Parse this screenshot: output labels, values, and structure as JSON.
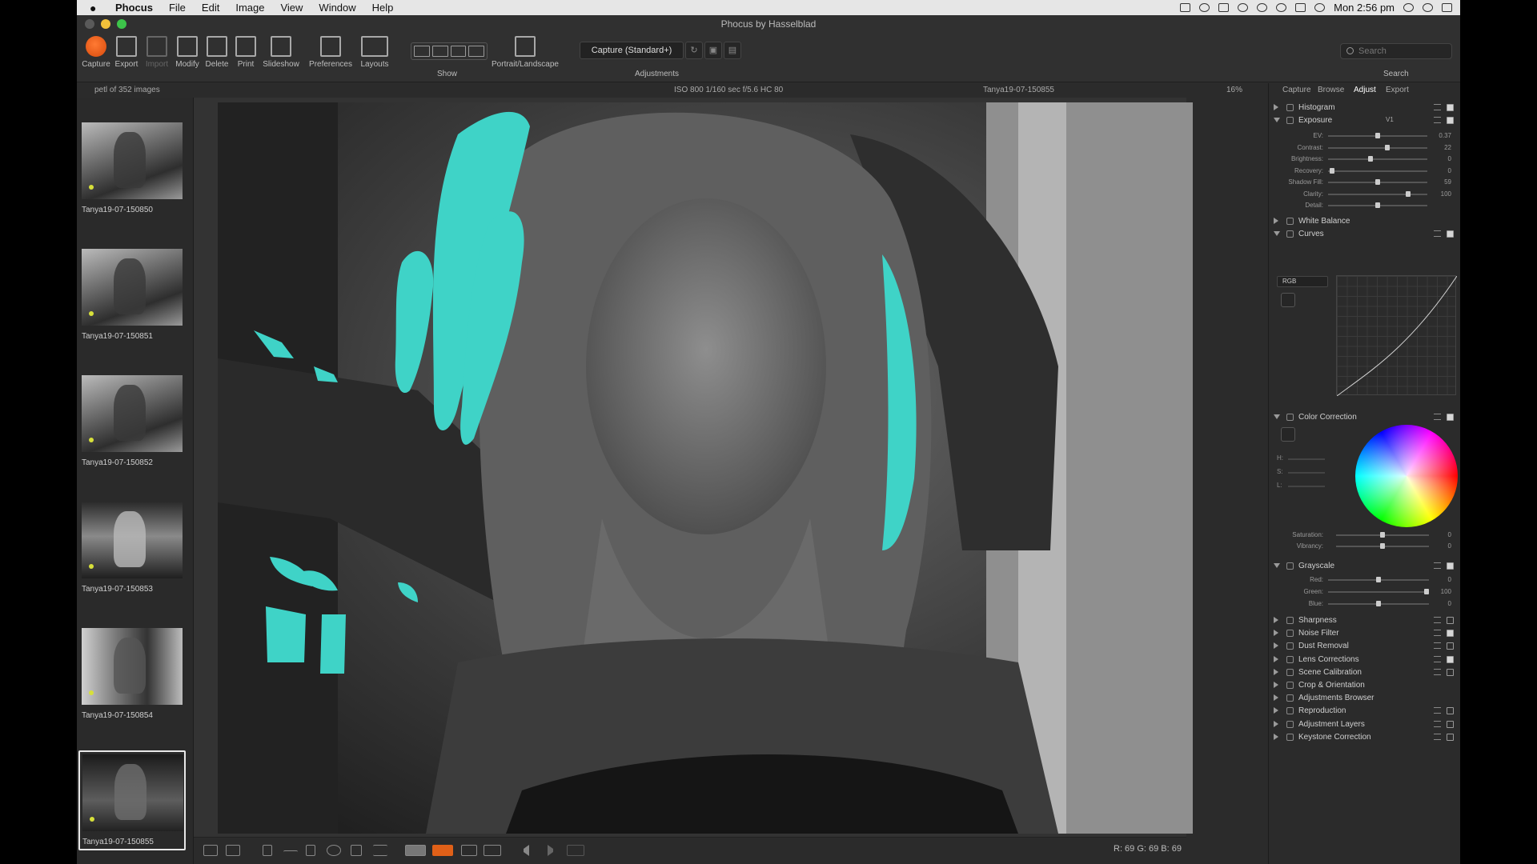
{
  "menubar": {
    "apple": "",
    "app": "Phocus",
    "items": [
      "File",
      "Edit",
      "Image",
      "View",
      "Window",
      "Help"
    ],
    "clock": "Mon 2:56 pm"
  },
  "window": {
    "title": "Phocus by Hasselblad"
  },
  "toolbar": {
    "capture": "Capture",
    "export": "Export",
    "import": "Import",
    "modify": "Modify",
    "delete": "Delete",
    "print": "Print",
    "slideshow": "Slideshow",
    "preferences": "Preferences",
    "layouts": "Layouts",
    "show": "Show",
    "portrait_landscape": "Portrait/Landscape",
    "adjustments_label": "Adjustments",
    "adjustments_value": "Capture (Standard+)",
    "search_label": "Search",
    "search_placeholder": "Search"
  },
  "infostrip": {
    "collection": "petl of 352 images",
    "exif": "ISO 800  1/160 sec  f/5.6  HC 80",
    "filename": "Tanya19-07-150855",
    "zoom": "16%"
  },
  "thumbnails": [
    {
      "name": "Tanya19-07-150850"
    },
    {
      "name": "Tanya19-07-150851"
    },
    {
      "name": "Tanya19-07-150852"
    },
    {
      "name": "Tanya19-07-150853"
    },
    {
      "name": "Tanya19-07-150854"
    },
    {
      "name": "Tanya19-07-150855"
    }
  ],
  "panel": {
    "tabs": [
      "Capture",
      "Browse",
      "Adjust",
      "Export"
    ],
    "active_tab": "Adjust",
    "histogram": "Histogram",
    "exposure": {
      "title": "Exposure",
      "version": "V1",
      "sliders": [
        {
          "label": "EV:",
          "value": "0.37",
          "level": 0.5
        },
        {
          "label": "Contrast:",
          "value": "22",
          "level": 0.6
        },
        {
          "label": "Brightness:",
          "value": "0",
          "level": 0.42
        },
        {
          "label": "Recovery:",
          "value": "0",
          "level": 0.02
        },
        {
          "label": "Shadow Fill:",
          "value": "59",
          "level": 0.5
        },
        {
          "label": "Clarity:",
          "value": "100",
          "level": 0.82
        },
        {
          "label": "Detail:",
          "value": "",
          "level": 0.5
        }
      ]
    },
    "white_balance": "White Balance",
    "curves": {
      "title": "Curves",
      "channel": "RGB"
    },
    "color_correction": {
      "title": "Color Correction",
      "h": "H:",
      "s": "S:",
      "l": "L:",
      "sliders": [
        {
          "label": "Saturation:",
          "value": "0",
          "level": 0.5
        },
        {
          "label": "Vibrancy:",
          "value": "0",
          "level": 0.5
        }
      ]
    },
    "grayscale": {
      "title": "Grayscale",
      "sliders": [
        {
          "label": "Red:",
          "value": "0",
          "level": 0.5
        },
        {
          "label": "Green:",
          "value": "100",
          "level": 1.0
        },
        {
          "label": "Blue:",
          "value": "0",
          "level": 0.5
        }
      ]
    },
    "sections": [
      {
        "name": "Sharpness",
        "checked": false
      },
      {
        "name": "Noise Filter",
        "checked": true
      },
      {
        "name": "Dust Removal",
        "checked": false
      },
      {
        "name": "Lens Corrections",
        "checked": true
      },
      {
        "name": "Scene Calibration",
        "checked": false
      },
      {
        "name": "Crop & Orientation",
        "checked": null
      },
      {
        "name": "Adjustments Browser",
        "checked": null
      },
      {
        "name": "Reproduction",
        "checked": false
      },
      {
        "name": "Adjustment Layers",
        "checked": false
      },
      {
        "name": "Keystone Correction",
        "checked": false
      }
    ]
  },
  "readout": {
    "rgb": "R:  69  G:  69  B:  69"
  },
  "colors": {
    "accent": "#e06018",
    "overexposure": "#3fd3c7",
    "panel_bg": "#2b2b2b"
  }
}
